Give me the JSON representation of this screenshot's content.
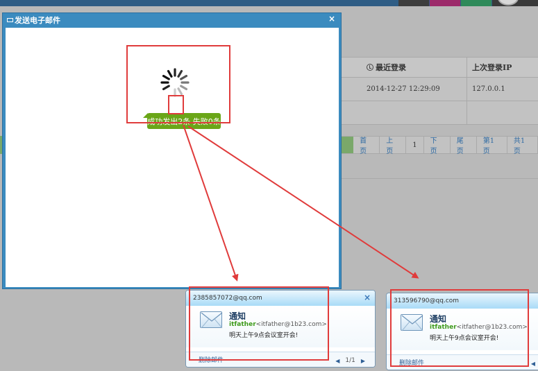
{
  "dialog": {
    "title": "发送电子邮件",
    "close_glyph": "×",
    "toast_text": "成功发出2条 失败0条"
  },
  "background_table": {
    "headers": [
      "最近登录",
      "上次登录IP"
    ],
    "row": [
      "2014-12-27 12:29:09",
      "127.0.0.1"
    ]
  },
  "pager": {
    "items": [
      "首页",
      "上页",
      "1",
      "下页",
      "尾页",
      "第1页",
      "共1页"
    ]
  },
  "notifications": [
    {
      "address": "2385857072@qq.com",
      "title": "通知",
      "sender_name": "itfather",
      "sender_email": "<itfather@1b23.com>",
      "message": "明天上午9点会议室开会!",
      "delete_label": "删除邮件",
      "page": "1/1",
      "close_glyph": "×"
    },
    {
      "address": "313596790@qq.com",
      "title": "通知",
      "sender_name": "itfather",
      "sender_email": "<itfather@1b23.com>",
      "message": "明天上午9点会议室开会!",
      "delete_label": "删除邮件"
    }
  ],
  "colors": {
    "annotation_red": "#e03b3b",
    "toast_green": "#6aa618",
    "dialog_blue": "#3b8bbf"
  }
}
